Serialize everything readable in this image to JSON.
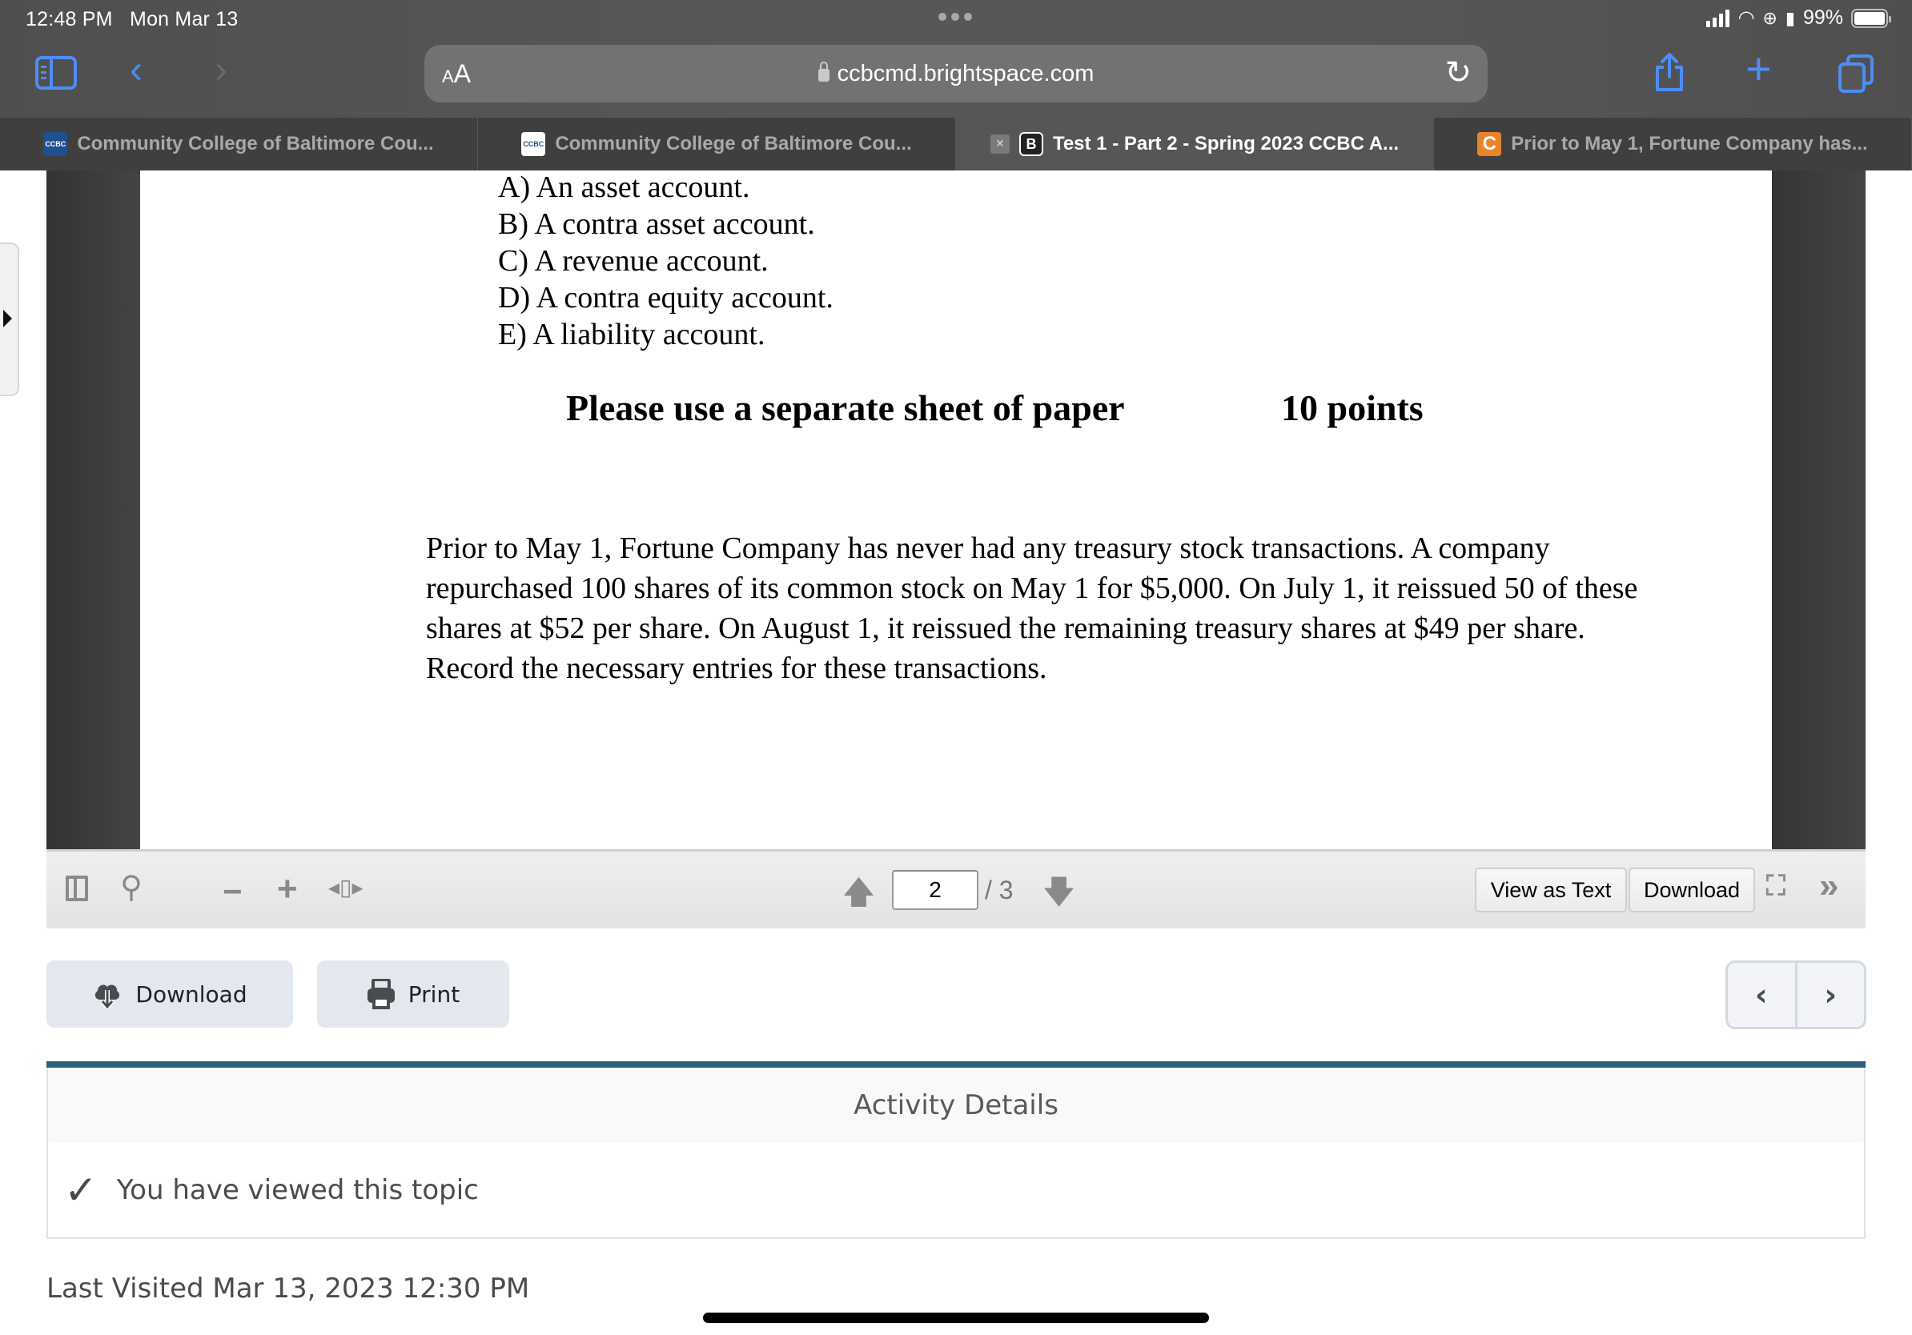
{
  "status_bar": {
    "time": "12:48 PM",
    "date": "Mon Mar 13",
    "battery_percent": "99%",
    "battery_level": 0.99,
    "icons": [
      "signal-icon",
      "wifi-icon",
      "orientation-lock-icon",
      "screen-time-icon",
      "battery-icon"
    ]
  },
  "browser": {
    "aa_label_small": "A",
    "aa_label_large": "A",
    "url": "ccbcmd.brightspace.com",
    "icons": {
      "sidebar": "sidebar-icon",
      "back": "‹",
      "forward": "›",
      "reload": "↻",
      "share": "share-icon",
      "new_tab": "+",
      "tabs": "tabs-icon"
    },
    "tabs": [
      {
        "title": "Community College of Baltimore Cou...",
        "favicon": "CCBC",
        "active": false
      },
      {
        "title": "Community College of Baltimore Cou...",
        "favicon": "CCBC",
        "active": false
      },
      {
        "title": "Test 1 - Part 2 - Spring 2023 CCBC A...",
        "favicon": "B",
        "active": true,
        "close": "×"
      },
      {
        "title": "Prior to May 1, Fortune Company has...",
        "favicon": "C",
        "active": false
      }
    ]
  },
  "document": {
    "options": [
      "A) An asset account.",
      "B) A contra asset account.",
      "C) A revenue account.",
      "D) A contra equity account.",
      "E) A liability account."
    ],
    "instruction": "Please use a separate sheet of paper",
    "points": "10 points",
    "problem": "Prior to May 1, Fortune Company has never had any treasury stock transactions. A company repurchased 100 shares of its common stock on May 1 for $5,000. On July 1, it reissued 50 of these shares at $52 per share. On August 1, it reissued the remaining treasury shares at $49 per share.  Record the necessary entries for these transactions."
  },
  "pdf_toolbar": {
    "current_page": "2",
    "total_pages": "/ 3",
    "view_as_text": "View as Text",
    "download": "Download",
    "icons": {
      "minus": "−",
      "plus": "+",
      "fit": "◂▯▸",
      "search": "⚲",
      "prev_page": "🡅",
      "next_page": "🡇",
      "fullscreen": "⛶",
      "more": "»"
    }
  },
  "actions": {
    "download": "Download",
    "print": "Print",
    "prev": "‹",
    "next": "›"
  },
  "activity": {
    "title": "Activity Details",
    "status": "You have viewed this topic",
    "check": "✓"
  },
  "last_visited": "Last Visited Mar 13, 2023 12:30 PM",
  "colors": {
    "safari_accent": "#4d8df5",
    "activity_bar": "#2a6080",
    "tab_c_favicon": "#e8842c",
    "action_button_bg": "#e3e8ef"
  }
}
